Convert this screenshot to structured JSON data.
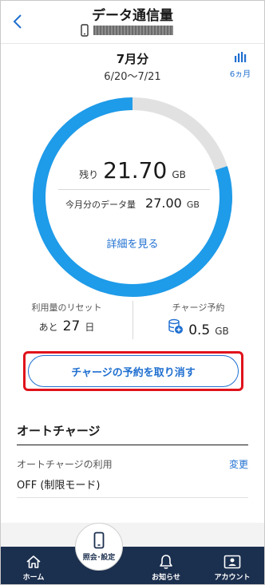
{
  "header": {
    "title": "データ通信量"
  },
  "usage": {
    "month": "7月分",
    "period": "6/20〜7/21",
    "history_label": "6ヵ月",
    "remaining_label": "残り",
    "remaining_value": "21.70",
    "remaining_unit": "GB",
    "month_data_label": "今月分のデータ量",
    "month_data_value": "27.00",
    "month_data_unit": "GB",
    "remaining_fraction": 0.8,
    "details_link": "詳細を見る",
    "ring_color": "#1e9be9",
    "ring_track_color": "#e1e1e1"
  },
  "stats": {
    "reset_label": "利用量のリセット",
    "reset_prefix": "あと",
    "reset_value": "27",
    "reset_unit": "日",
    "charge_label": "チャージ予約",
    "charge_value": "0.5",
    "charge_unit": "GB"
  },
  "actions": {
    "cancel_label": "チャージの予約を取り消す"
  },
  "autocharge": {
    "section_title": "オートチャージ",
    "usage_label": "オートチャージの利用",
    "change_label": "変更",
    "value": "OFF (制限モード)"
  },
  "nav": {
    "home": "ホーム",
    "inquiry": "照会･設定",
    "notices": "お知らせ",
    "account": "アカウント"
  },
  "colors": {
    "accent": "#1f6fd0",
    "highlight": "#e0121b",
    "nav_bg": "#1b2f4e"
  }
}
